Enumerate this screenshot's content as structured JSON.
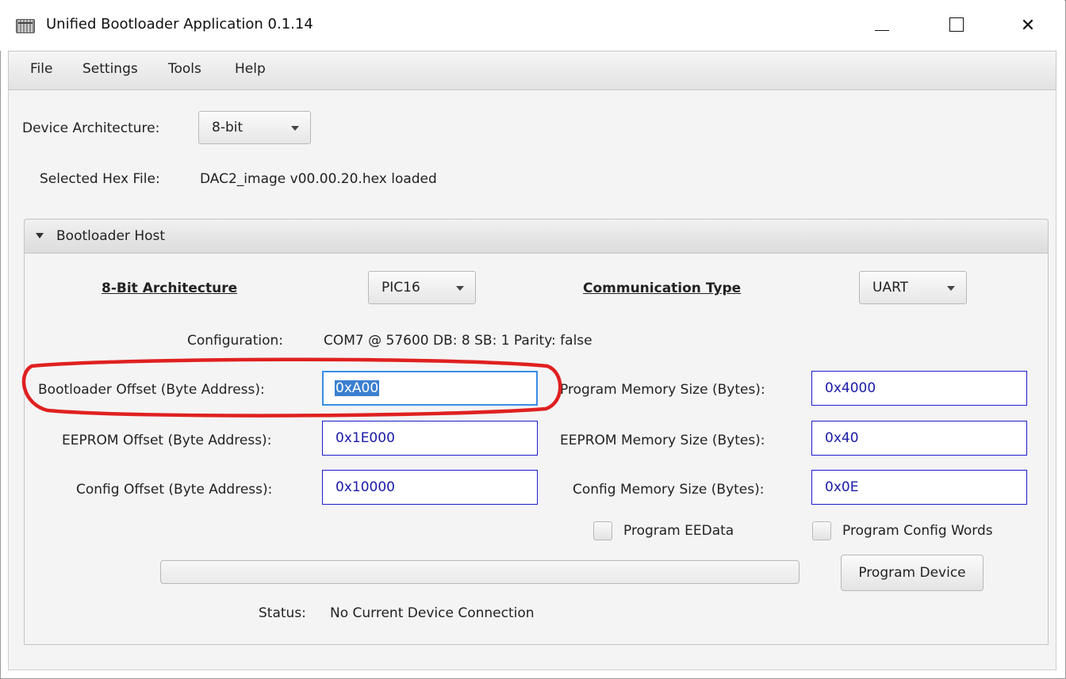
{
  "window": {
    "title": "Unified Bootloader Application 0.1.14",
    "controls": {
      "minimize": "—",
      "maximize": "□",
      "close": "✕"
    }
  },
  "menubar": {
    "items": [
      "File",
      "Settings",
      "Tools",
      "Help"
    ]
  },
  "device": {
    "architecture_label": "Device Architecture:",
    "architecture_value": "8-bit",
    "hex_label": "Selected Hex File:",
    "hex_value": "DAC2_image v00.00.20.hex loaded"
  },
  "pane": {
    "title": "Bootloader Host",
    "arch_heading": "8-Bit Architecture",
    "family_value": "PIC16",
    "comm_heading": "Communication Type",
    "comm_value": "UART",
    "config_label": "Configuration:",
    "config_value": "COM7 @ 57600 DB: 8 SB: 1 Parity: false",
    "fields": {
      "bootloader_offset": {
        "label": "Bootloader Offset (Byte Address):",
        "value": "0xA00"
      },
      "program_memory_size": {
        "label": "Program Memory Size (Bytes):",
        "value": "0x4000"
      },
      "eeprom_offset": {
        "label": "EEPROM Offset (Byte Address):",
        "value": "0x1E000"
      },
      "eeprom_memory_size": {
        "label": "EEPROM Memory Size (Bytes):",
        "value": "0x40"
      },
      "config_offset": {
        "label": "Config Offset (Byte Address):",
        "value": "0x10000"
      },
      "config_memory_size": {
        "label": "Config Memory Size (Bytes):",
        "value": "0x0E"
      }
    },
    "checkboxes": {
      "program_eedata": {
        "label": "Program EEData",
        "checked": false
      },
      "program_config_words": {
        "label": "Program Config Words",
        "checked": false
      }
    },
    "progress": 0,
    "program_button": "Program Device",
    "status_label": "Status:",
    "status_value": "No Current Device Connection"
  },
  "annotation": {
    "highlight_color": "#e02020"
  },
  "colors": {
    "field_border": "#1c1ccf",
    "focus": "#3a8ee6",
    "selection": "#3a7fd0"
  }
}
